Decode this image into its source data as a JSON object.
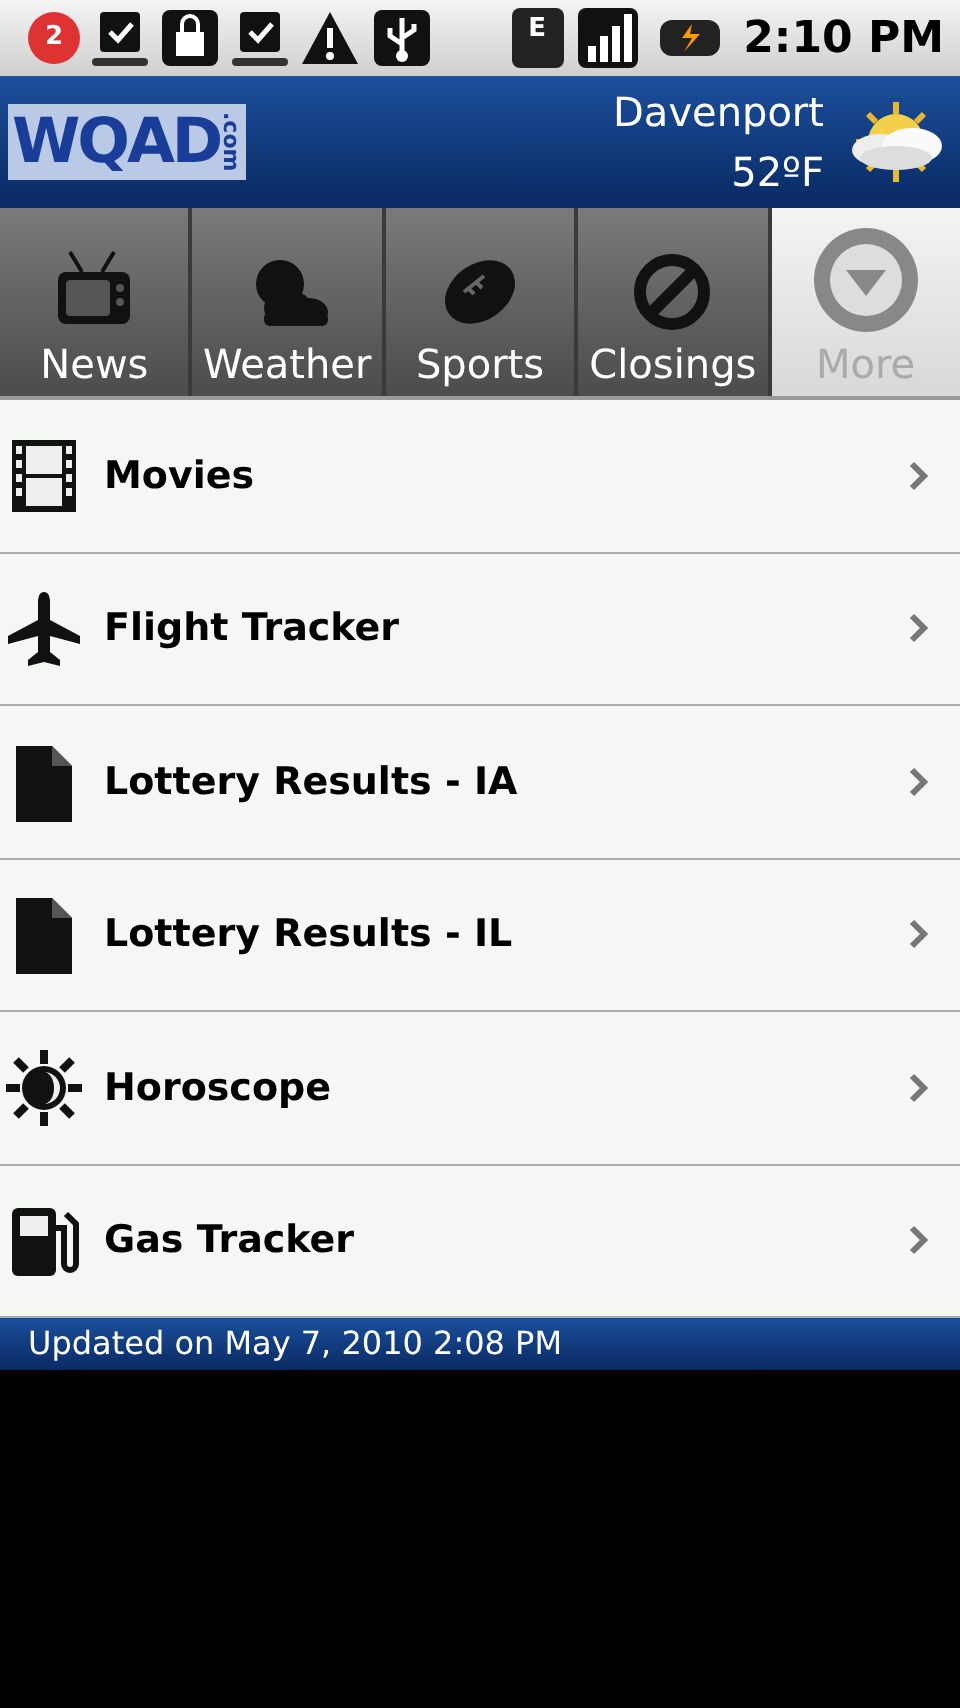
{
  "status_bar": {
    "notification_count": "2",
    "network": "E",
    "time": "2:10 PM"
  },
  "header": {
    "logo": "WQAD",
    "logo_suffix": ".com",
    "city": "Davenport",
    "temperature": "52ºF"
  },
  "tabs": [
    {
      "label": "News",
      "kind": "tv",
      "selected": false
    },
    {
      "label": "Weather",
      "kind": "weather",
      "selected": false
    },
    {
      "label": "Sports",
      "kind": "football",
      "selected": false
    },
    {
      "label": "Closings",
      "kind": "closed",
      "selected": false
    },
    {
      "label": "More",
      "kind": "more",
      "selected": true
    }
  ],
  "items": [
    {
      "label": "Movies",
      "kind": "film"
    },
    {
      "label": "Flight Tracker",
      "kind": "plane"
    },
    {
      "label": "Lottery Results - IA",
      "kind": "document"
    },
    {
      "label": "Lottery Results - IL",
      "kind": "document"
    },
    {
      "label": "Horoscope",
      "kind": "sun"
    },
    {
      "label": "Gas Tracker",
      "kind": "gas"
    }
  ],
  "footer": "Updated on May 7, 2010 2:08 PM"
}
